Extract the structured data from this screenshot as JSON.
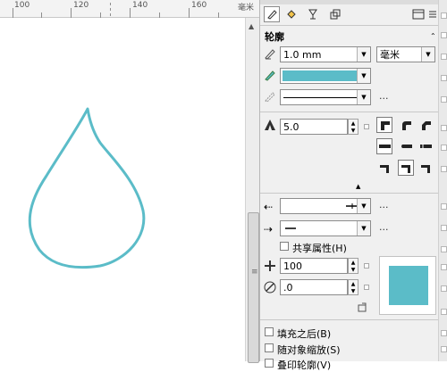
{
  "ruler": {
    "labels": [
      "100",
      "120",
      "140",
      "160"
    ],
    "unit": "毫米"
  },
  "canvas": {
    "stroke_color": "#5bbcc8"
  },
  "toolbar": {
    "icons": [
      "outline-pen-icon",
      "fill-bucket-icon",
      "goblet-icon",
      "stack-icon",
      "window-icon",
      "list-icon"
    ]
  },
  "outline": {
    "title": "轮廓",
    "width_value": "1.0 mm",
    "unit_value": "毫米",
    "color": "#5bbcc8",
    "more": "...",
    "miter_value": "5.0",
    "arrow_more": "...",
    "share_label": "共享属性(H)",
    "stretch_value": "100",
    "angle_value": ".0",
    "preview_color": "#5bbcc8",
    "fill_behind_label": "填充之后(B)",
    "scale_label": "随对象缩放(S)",
    "overflow_label": "叠印轮廓(V)"
  }
}
